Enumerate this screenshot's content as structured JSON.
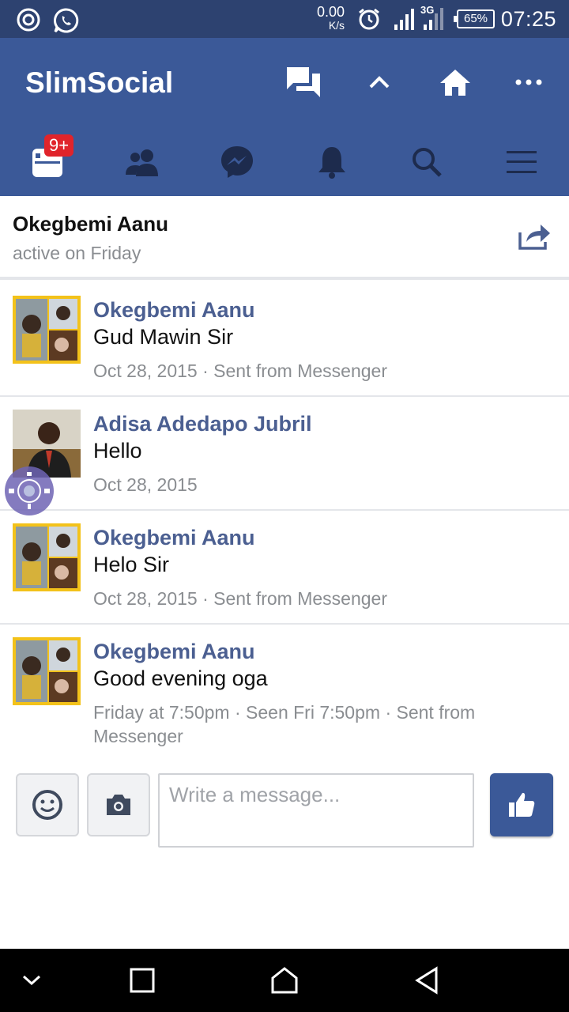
{
  "status_bar": {
    "speed_value": "0.00",
    "speed_unit": "K/s",
    "network": "3G",
    "battery": "65%",
    "time": "07:25",
    "icons": [
      "camera-notification-icon",
      "whatsapp-icon",
      "alarm-icon",
      "signal-icon",
      "signal-3g-icon",
      "battery-icon"
    ]
  },
  "app_bar": {
    "title": "SlimSocial",
    "actions": [
      "messages-icon",
      "scroll-up-icon",
      "home-icon",
      "more-icon"
    ]
  },
  "tab_bar": {
    "tabs": [
      "news-feed-tab",
      "friends-tab",
      "messenger-tab",
      "notifications-tab",
      "search-tab",
      "menu-tab"
    ],
    "badge": "9+"
  },
  "conversation": {
    "name": "Okegbemi Aanu",
    "status": "active on Friday"
  },
  "messages": [
    {
      "author": "Okegbemi Aanu",
      "text": "Gud Mawin Sir",
      "meta": "Oct 28, 2015 · Sent from Messenger"
    },
    {
      "author": "Adisa Adedapo Jubril",
      "text": "Hello",
      "meta": "Oct 28, 2015"
    },
    {
      "author": "Okegbemi Aanu",
      "text": "Helo Sir",
      "meta": "Oct 28, 2015 · Sent from Messenger"
    },
    {
      "author": "Okegbemi Aanu",
      "text": "Good evening oga",
      "meta": "Friday at 7:50pm · Seen Fri 7:50pm · Sent from Messenger"
    }
  ],
  "composer": {
    "placeholder": "Write a message...",
    "value": ""
  },
  "colors": {
    "brand": "#3b5998",
    "status_bar": "#2d4270",
    "author": "#4b5f91",
    "meta": "#8a8d91",
    "badge": "#e0242b"
  }
}
